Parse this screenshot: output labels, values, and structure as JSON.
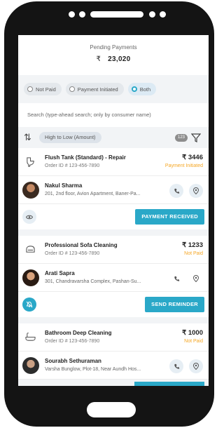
{
  "summary": {
    "label": "Pending Payments",
    "currency": "₹",
    "amount": "23,020"
  },
  "filters": [
    {
      "label": "Not Paid",
      "selected": false
    },
    {
      "label": "Payment Initiated",
      "selected": false
    },
    {
      "label": "Both",
      "selected": true
    }
  ],
  "search": {
    "placeholder": "Search (type-ahead search; only by consumer name)"
  },
  "sort": {
    "label": "High to Low (Amount)",
    "count": "123"
  },
  "cards": [
    {
      "service": "Flush Tank (Standard) - Repair",
      "order_id": "Order ID # 123-456-7890",
      "amount": "₹ 3446",
      "status": "Payment Initiated",
      "customer": "Nakul Sharma",
      "address": "201, 2nd floor, Avion Apartment, Baner-Pa...",
      "action": "PAYMENT RECEIVED"
    },
    {
      "service": "Professional Sofa Cleaning",
      "order_id": "Order ID # 123-456-7890",
      "amount": "₹ 1233",
      "status": "Not Paid",
      "customer": "Arati Sapra",
      "address": "301, Chandravarsha Complex, Pashan-Su...",
      "action": "SEND REMINDER"
    },
    {
      "service": "Bathroom Deep Cleaning",
      "order_id": "Order ID # 123-456-7890",
      "amount": "₹ 1000",
      "status": "Not Paid",
      "customer": "Sourabh Sethuraman",
      "address": "Varsha Bunglow, Plot-18, Near Aundh Hos..."
    }
  ],
  "colors": {
    "accent": "#2aa8c8",
    "status": "#f5a623",
    "frame": "#141414"
  }
}
